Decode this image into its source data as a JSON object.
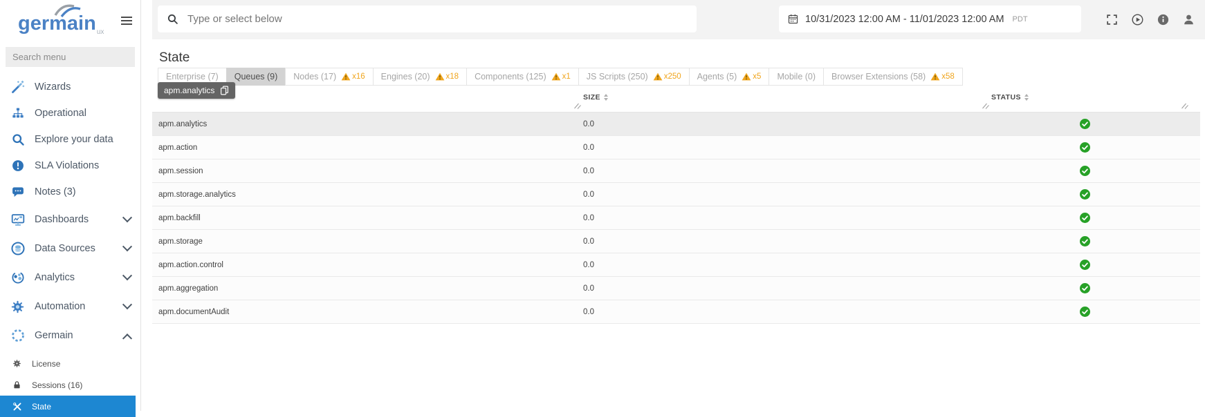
{
  "colors": {
    "accent_blue": "#3d7ec4",
    "selected_blue": "#1d87d2",
    "warning_orange": "#f0a51d",
    "success_green": "#27a127",
    "selected_tab_gray": "#d3d3d3"
  },
  "sidebar": {
    "logo": {
      "text": "germain",
      "sub": "ux"
    },
    "search_placeholder": "Search menu",
    "items": [
      {
        "label": "Wizards",
        "icon": "wand"
      },
      {
        "label": "Operational",
        "icon": "sitemap"
      },
      {
        "label": "Explore your data",
        "icon": "search"
      },
      {
        "label": "SLA Violations",
        "icon": "exclamation-circle"
      },
      {
        "label": "Notes (3)",
        "icon": "comment"
      },
      {
        "label": "Dashboards",
        "icon": "dashboard",
        "chevron": "down",
        "group": true
      },
      {
        "label": "Data Sources",
        "icon": "data-sources",
        "chevron": "down",
        "group": true
      },
      {
        "label": "Analytics",
        "icon": "analytics",
        "chevron": "down",
        "group": true
      },
      {
        "label": "Automation",
        "icon": "automation",
        "chevron": "down",
        "group": true
      },
      {
        "label": "Germain",
        "icon": "germain",
        "chevron": "up",
        "group": true
      }
    ],
    "subitems": [
      {
        "label": "License",
        "icon": "license"
      },
      {
        "label": "Sessions (16)",
        "icon": "lock"
      },
      {
        "label": "State",
        "icon": "tools",
        "selected": true
      }
    ]
  },
  "header": {
    "search_placeholder": "Type or select below",
    "date_range": "10/31/2023 12:00 AM - 11/01/2023 12:00 AM",
    "timezone": "PDT",
    "icons": [
      "fullscreen",
      "play",
      "info",
      "user"
    ]
  },
  "page": {
    "title": "State"
  },
  "tabs": [
    {
      "label": "Enterprise (7)"
    },
    {
      "label": "Queues (9)",
      "selected": true
    },
    {
      "label": "Nodes (17)",
      "warning": "x16"
    },
    {
      "label": "Engines (20)",
      "warning": "x18"
    },
    {
      "label": "Components (125)",
      "warning": "x1"
    },
    {
      "label": "JS Scripts (250)",
      "warning": "x250"
    },
    {
      "label": "Agents (5)",
      "warning": "x5"
    },
    {
      "label": "Mobile (0)"
    },
    {
      "label": "Browser Extensions (58)",
      "warning": "x58"
    }
  ],
  "tooltip": {
    "text": "apm.analytics",
    "icon": "copy"
  },
  "table": {
    "columns": [
      {
        "label": "SIZE",
        "sortable": true
      },
      {
        "label": "STATUS",
        "sortable": true
      }
    ],
    "rows": [
      {
        "name": "apm.analytics",
        "size": "0.0",
        "status": "ok",
        "selected": true
      },
      {
        "name": "apm.action",
        "size": "0.0",
        "status": "ok"
      },
      {
        "name": "apm.session",
        "size": "0.0",
        "status": "ok"
      },
      {
        "name": "apm.storage.analytics",
        "size": "0.0",
        "status": "ok"
      },
      {
        "name": "apm.backfill",
        "size": "0.0",
        "status": "ok"
      },
      {
        "name": "apm.storage",
        "size": "0.0",
        "status": "ok"
      },
      {
        "name": "apm.action.control",
        "size": "0.0",
        "status": "ok"
      },
      {
        "name": "apm.aggregation",
        "size": "0.0",
        "status": "ok"
      },
      {
        "name": "apm.documentAudit",
        "size": "0.0",
        "status": "ok"
      }
    ]
  }
}
